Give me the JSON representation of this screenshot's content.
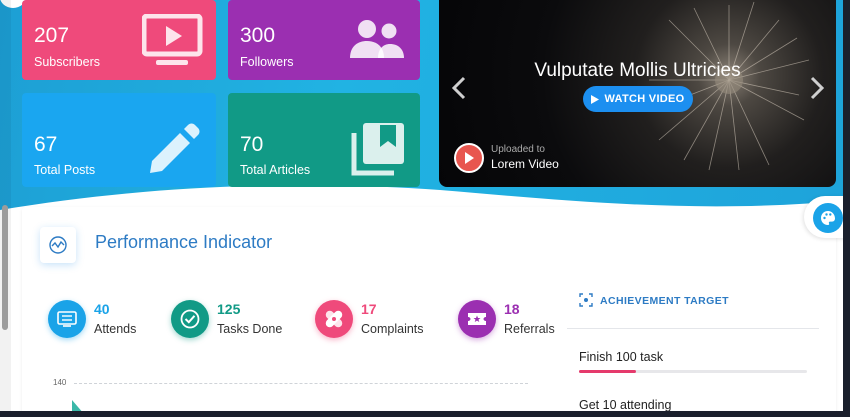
{
  "stats": {
    "subscribers": {
      "value": "207",
      "label": "Subscribers",
      "icon": "tv-play-icon",
      "color": "#ef4a7b"
    },
    "followers": {
      "value": "300",
      "label": "Followers",
      "icon": "users-icon",
      "color": "#9b2fb1"
    },
    "posts": {
      "value": "67",
      "label": "Total Posts",
      "icon": "pencil-icon",
      "color": "#1aa6f0"
    },
    "articles": {
      "value": "70",
      "label": "Total Articles",
      "icon": "bookmark-stack-icon",
      "color": "#119a86"
    }
  },
  "video": {
    "title": "Vulputate Mollis Ultricies",
    "button_label": "WATCH VIDEO",
    "uploaded_label": "Uploaded to",
    "uploader": "Lorem Video",
    "accent": "#1c8ff0"
  },
  "performance": {
    "title": "Performance Indicator",
    "metrics": [
      {
        "value": "40",
        "label": "Attends",
        "icon": "monitor-list-icon",
        "color": "#1aa3e8"
      },
      {
        "value": "125",
        "label": "Tasks Done",
        "icon": "check-circle-icon",
        "color": "#119a86"
      },
      {
        "value": "17",
        "label": "Complaints",
        "icon": "bandage-icon",
        "color": "#ef4a7b"
      },
      {
        "value": "18",
        "label": "Referrals",
        "icon": "ticket-star-icon",
        "color": "#9b2fb1"
      }
    ],
    "achievement": {
      "title": "ACHIEVEMENT TARGET",
      "tasks": [
        {
          "label": "Finish 100 task",
          "progress": 0.25
        },
        {
          "label": "Get 10 attending",
          "progress": 0
        }
      ]
    },
    "chart": {
      "y_tick": "140"
    }
  }
}
